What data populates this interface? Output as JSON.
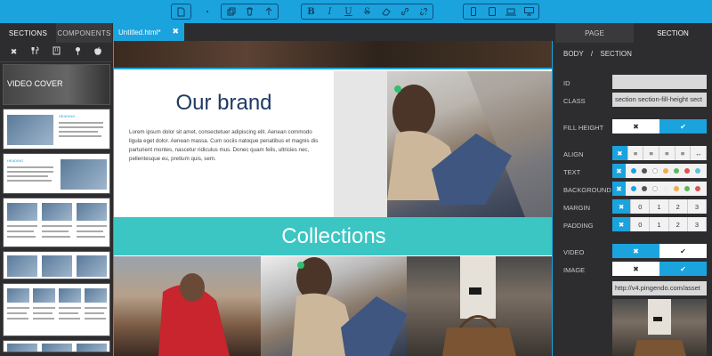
{
  "toolbar": {
    "groups": [
      {
        "icons": [
          "page-icon"
        ]
      },
      {
        "icons": [
          "copy-icon",
          "trash-icon",
          "move-up-icon"
        ]
      },
      {
        "icons": [
          "bold-icon",
          "italic-icon",
          "underline-icon",
          "strikethrough-icon",
          "eraser-icon",
          "link-icon",
          "unlink-icon"
        ]
      },
      {
        "icons": [
          "phone-icon",
          "tablet-icon",
          "laptop-icon",
          "desktop-icon"
        ]
      }
    ],
    "glyphs": {
      "bold": "B",
      "italic": "I",
      "underline": "U",
      "strike": "S"
    }
  },
  "left_panel": {
    "tabs": [
      "SECTIONS",
      "COMPONENTS"
    ],
    "active_tab": "SECTIONS",
    "filters": [
      "close-icon",
      "cutlery-icon",
      "building-icon",
      "pin-icon",
      "apple-icon"
    ],
    "thumbs": [
      {
        "title": "VIDEO COVER"
      },
      {
        "title": "HEADING"
      },
      {
        "title": "HEADING"
      },
      {
        "title": ""
      },
      {
        "title": ""
      },
      {
        "title": ""
      },
      {
        "title": ""
      }
    ]
  },
  "canvas": {
    "file_tab": "Untitled.html*",
    "close_glyph": "✖",
    "brand_heading": "Our brand",
    "brand_text": "Lorem ipsum dolor sit amet, consectetuer adipiscing elit. Aenean commodo ligula eget dolor. Aenean massa. Cum sociis natoque penatibus et magnis dis parturient montes, nascetur ridiculus mus. Donec quam felis, ultricies nec, pellentesque eu, pretium quis, sem.",
    "collections_heading": "Collections"
  },
  "right_panel": {
    "tabs": [
      "PAGE",
      "SECTION"
    ],
    "active_tab": "SECTION",
    "breadcrumb": [
      "BODY",
      "/",
      "SECTION"
    ],
    "labels": {
      "id": "ID",
      "class": "CLASS",
      "fill_height": "FILL HEIGHT",
      "align": "ALIGN",
      "text": "TEXT",
      "background": "BACKGROUND",
      "margin": "MARGIN",
      "padding": "PADDING",
      "video": "VIDEO",
      "image": "IMAGE"
    },
    "id_value": "",
    "class_value": "section section-fill-height sect",
    "image_value": "http://v4.pingendo.com/asset",
    "toggle_off": "✖",
    "toggle_on": "✔",
    "fill_height_on": true,
    "video_on": false,
    "image_on": true,
    "align_options": [
      "✖",
      "≡",
      "≡",
      "≡",
      "≡",
      "↔"
    ],
    "margin_options": [
      "✖",
      "0",
      "1",
      "2",
      "3"
    ],
    "padding_options": [
      "✖",
      "0",
      "1",
      "2",
      "3"
    ],
    "text_colors": [
      "#1ba3de",
      "#555555",
      "#ffffff",
      "#f0ad4e",
      "#5cb85c",
      "#d9534f",
      "#5bc0de"
    ],
    "background_colors": [
      "#1ba3de",
      "#555555",
      "#ffffff",
      "#eeeeee",
      "#f0ad4e",
      "#5cb85c",
      "#d9534f"
    ]
  }
}
